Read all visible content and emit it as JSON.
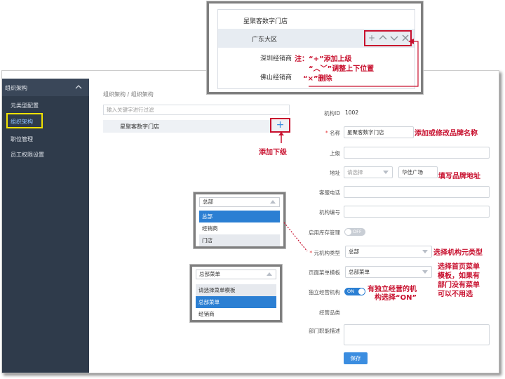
{
  "sidebar": {
    "header": "组织架构",
    "items": [
      "元类型配置",
      "组织架构",
      "职位管理",
      "员工权限设置"
    ]
  },
  "breadcrumb": [
    "组织架构",
    "组织架构"
  ],
  "tree": {
    "search_placeholder": "输入关键字进行过滤",
    "root_label": "星聚客数字门店",
    "add_child_icon": "+"
  },
  "top_callout": {
    "root": "星聚客数字门店",
    "region": "广东大区",
    "children": [
      "深圳经销商",
      "佛山经销商"
    ],
    "icons": [
      "plus-icon",
      "chevron-up-icon",
      "chevron-down-icon",
      "close-icon"
    ],
    "note_lines": [
      "注：“+”添加上级",
      "“︿﹀”调整上下位置",
      "“×”删除"
    ]
  },
  "form": {
    "org_id_label": "机构ID",
    "org_id_value": "1002",
    "name_label": "名称",
    "name_value": "星聚客数字门店",
    "parent_label": "上级",
    "address_label": "地址",
    "address_select_placeholder": "请选择",
    "address_value": "华佳广场",
    "service_phone_label": "客服电话",
    "org_code_label": "机构编号",
    "inventory_label": "启用库存管理",
    "inventory_state": "OFF",
    "meta_type_label": "元机构类型",
    "meta_type_value": "总部",
    "menu_template_label": "页面菜单模板",
    "menu_template_value": "总部菜单",
    "independent_label": "独立经营机构",
    "independent_state": "ON",
    "category_label": "经营品类",
    "description_label": "部门职能描述",
    "save_label": "保存"
  },
  "popup_meta_type": {
    "selected": "总部",
    "options": [
      "总部",
      "经销商",
      "门店"
    ]
  },
  "popup_menu_template": {
    "selected": "总部菜单",
    "options": [
      "请选择菜单模板",
      "总部菜单",
      "经销商"
    ]
  },
  "annotations": {
    "add_child": "添加下级",
    "name": "添加或修改品牌名称",
    "address": "填写品牌地址",
    "meta_type": "选择机构元类型",
    "menu_template": [
      "选择首页菜单",
      "模板，如果有",
      "部门没有菜单",
      "可以不用选"
    ],
    "independent": [
      "有独立经营的机",
      "构选择“ON”"
    ]
  },
  "colors": {
    "sidebar_bg": "#2f3b4b",
    "accent_blue": "#3b8de0",
    "annotation_red": "#c8102e",
    "highlight_yellow": "#f2e200"
  }
}
